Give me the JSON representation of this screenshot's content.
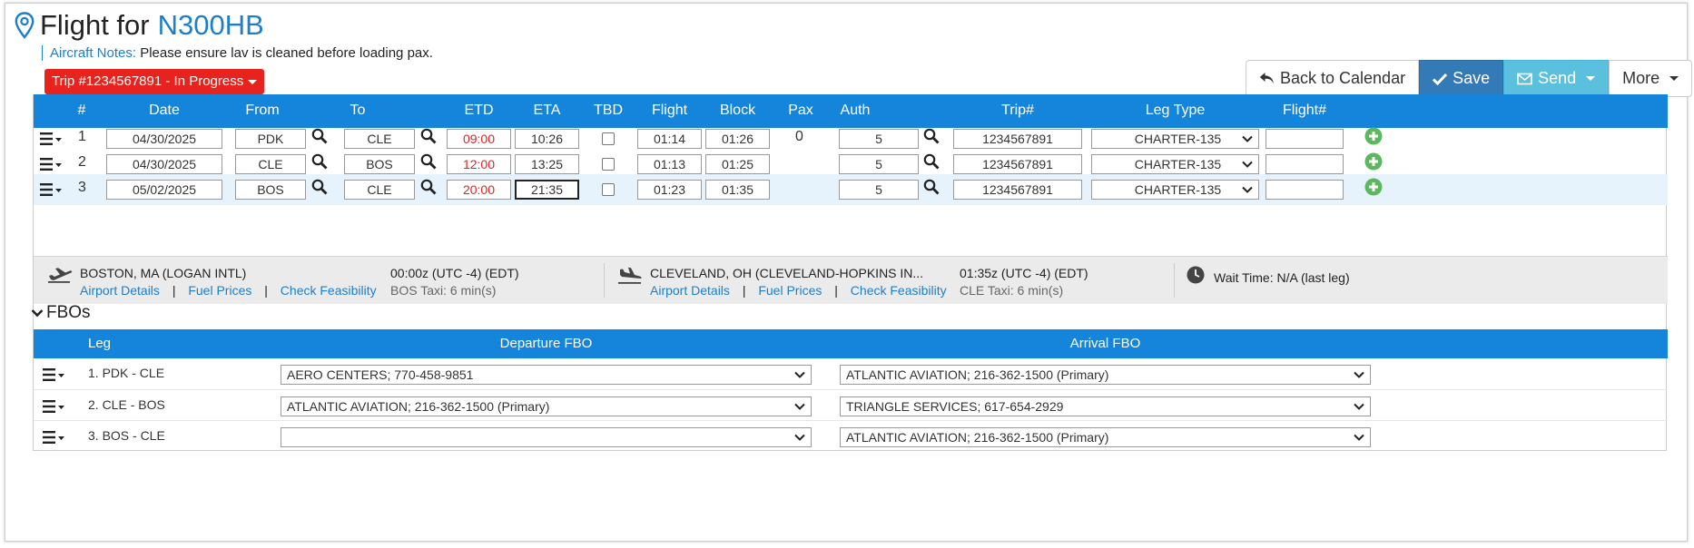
{
  "header": {
    "title_prefix": "Flight for",
    "tail_number": "N300HB",
    "notes_label": "Aircraft Notes:",
    "notes_text": "Please ensure lav is cleaned before loading pax.",
    "trip_badge": "Trip #1234567891 - In Progress",
    "icon": "map-pin-icon"
  },
  "toolbar": {
    "back_label": "Back to Calendar",
    "save_label": "Save",
    "send_label": "Send",
    "more_label": "More"
  },
  "legs_table": {
    "columns": [
      "#",
      "Date",
      "From",
      "To",
      "ETD",
      "ETA",
      "TBD",
      "Flight",
      "Block",
      "Pax",
      "Auth",
      "Trip#",
      "Leg Type",
      "Flight#"
    ],
    "rows": [
      {
        "num": "1",
        "date": "04/30/2025",
        "from": "PDK",
        "to": "CLE",
        "etd": "09:00",
        "eta": "10:26",
        "tbd": false,
        "flight": "01:14",
        "block": "01:26",
        "pax": "0",
        "auth": "5",
        "trip": "1234567891",
        "leg_type": "CHARTER-135",
        "flight_no": ""
      },
      {
        "num": "2",
        "date": "04/30/2025",
        "from": "CLE",
        "to": "BOS",
        "etd": "12:00",
        "eta": "13:25",
        "tbd": false,
        "flight": "01:13",
        "block": "01:25",
        "pax": "",
        "auth": "5",
        "trip": "1234567891",
        "leg_type": "CHARTER-135",
        "flight_no": ""
      },
      {
        "num": "3",
        "date": "05/02/2025",
        "from": "BOS",
        "to": "CLE",
        "etd": "20:00",
        "eta": "21:35",
        "tbd": false,
        "flight": "01:23",
        "block": "01:35",
        "pax": "",
        "auth": "5",
        "trip": "1234567891",
        "leg_type": "CHARTER-135",
        "flight_no": ""
      }
    ],
    "etd_color": "#e8221c"
  },
  "airport_info": {
    "departure": {
      "name": "BOSTON, MA (LOGAN INTL)",
      "time": "00:00z (UTC -4) (EDT)",
      "taxi": "BOS Taxi: 6 min(s)",
      "links": [
        "Airport Details",
        "Fuel Prices",
        "Check Feasibility"
      ]
    },
    "arrival": {
      "name": "CLEVELAND, OH (CLEVELAND-HOPKINS IN...",
      "time": "01:35z (UTC -4) (EDT)",
      "taxi": "CLE Taxi: 6 min(s)",
      "links": [
        "Airport Details",
        "Fuel Prices",
        "Check Feasibility"
      ]
    },
    "wait_time": "Wait Time: N/A (last leg)",
    "separator": "|"
  },
  "fbos": {
    "toggle_label": "FBOs",
    "columns": [
      "Leg",
      "Departure FBO",
      "Arrival FBO"
    ],
    "rows": [
      {
        "leg": "1. PDK - CLE",
        "departure": "AERO CENTERS; 770-458-9851",
        "arrival": "ATLANTIC AVIATION; 216-362-1500 (Primary)"
      },
      {
        "leg": "2. CLE - BOS",
        "departure": "ATLANTIC AVIATION; 216-362-1500 (Primary)",
        "arrival": "TRIANGLE SERVICES; 617-654-2929"
      },
      {
        "leg": "3. BOS - CLE",
        "departure": "",
        "arrival": "ATLANTIC AVIATION; 216-362-1500 (Primary)"
      }
    ]
  },
  "colors": {
    "header_blue": "#1585dc",
    "link_blue": "#1e7ec8",
    "badge_red": "#e8221c",
    "save_blue": "#337ab7",
    "send_cyan": "#5bc0de",
    "add_green": "#5cb85c"
  }
}
